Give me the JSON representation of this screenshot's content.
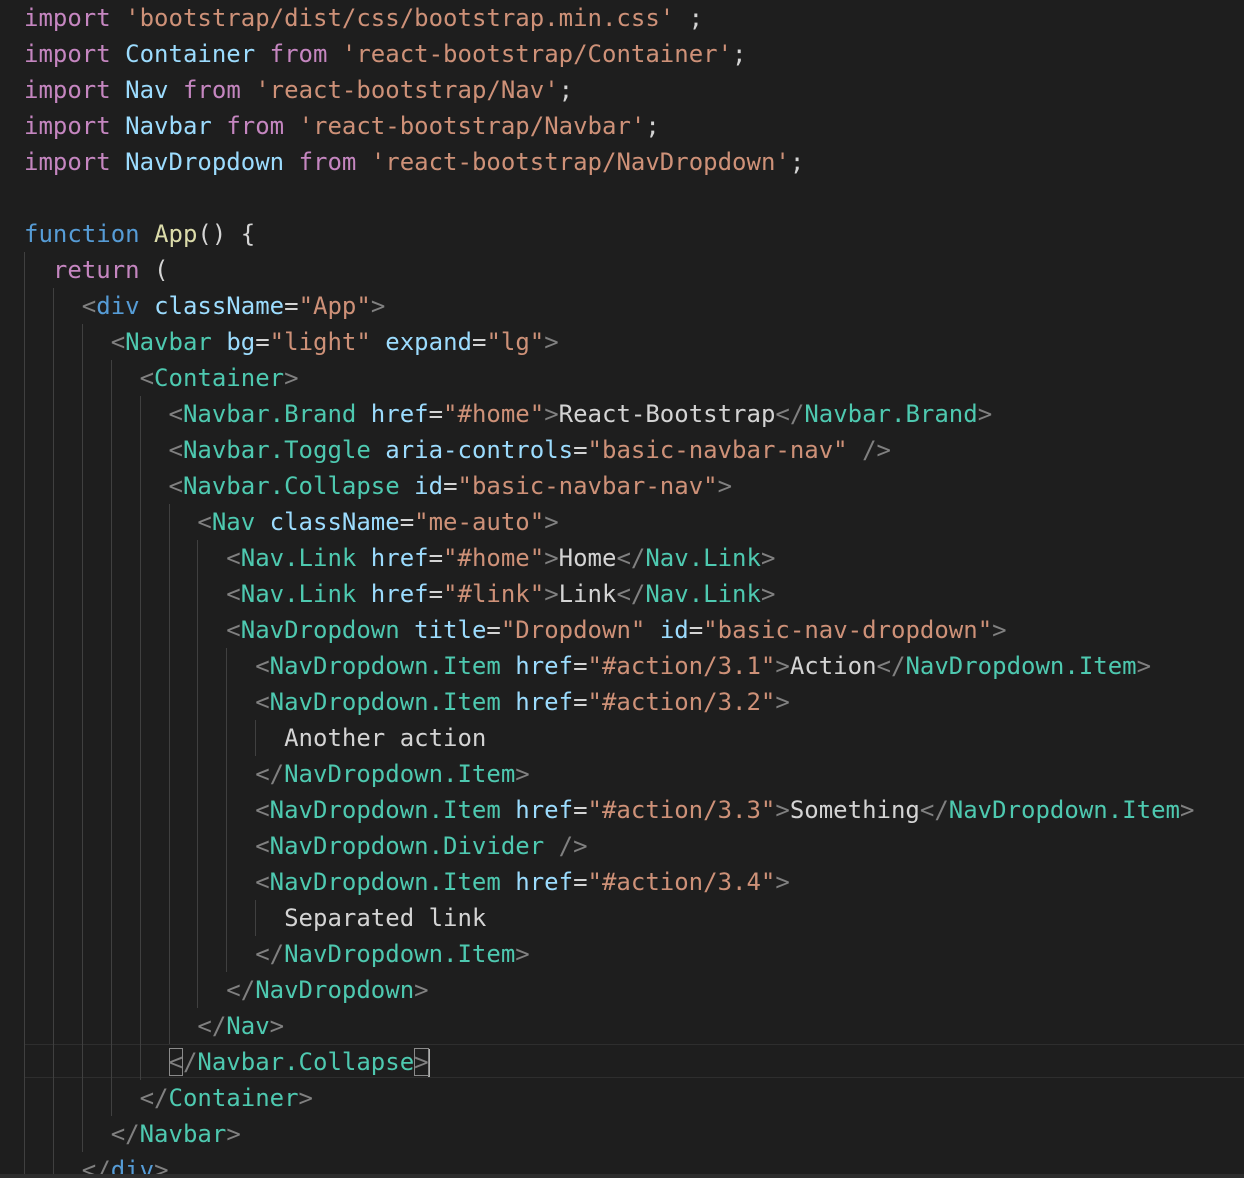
{
  "editor": {
    "colors": {
      "background": "#1e1e1e",
      "plain": "#d4d4d4",
      "keyword": "#c586c0",
      "storage": "#569cd6",
      "identifier": "#9cdcfe",
      "function": "#dcdcaa",
      "string": "#ce9178",
      "tag": "#4ec9b0",
      "tag_punct": "#808080",
      "attr": "#9cdcfe",
      "text": "#d4d4d4"
    },
    "lines": [
      [
        [
          "kw",
          "import"
        ],
        [
          "p",
          " "
        ],
        [
          "str",
          "'bootstrap/dist/css/bootstrap.min.css'"
        ],
        [
          "p",
          " ;"
        ]
      ],
      [
        [
          "kw",
          "import"
        ],
        [
          "p",
          " "
        ],
        [
          "id",
          "Container"
        ],
        [
          "p",
          " "
        ],
        [
          "kw",
          "from"
        ],
        [
          "p",
          " "
        ],
        [
          "str",
          "'react-bootstrap/Container'"
        ],
        [
          "p",
          ";"
        ]
      ],
      [
        [
          "kw",
          "import"
        ],
        [
          "p",
          " "
        ],
        [
          "id",
          "Nav"
        ],
        [
          "p",
          " "
        ],
        [
          "kw",
          "from"
        ],
        [
          "p",
          " "
        ],
        [
          "str",
          "'react-bootstrap/Nav'"
        ],
        [
          "p",
          ";"
        ]
      ],
      [
        [
          "kw",
          "import"
        ],
        [
          "p",
          " "
        ],
        [
          "id",
          "Navbar"
        ],
        [
          "p",
          " "
        ],
        [
          "kw",
          "from"
        ],
        [
          "p",
          " "
        ],
        [
          "str",
          "'react-bootstrap/Navbar'"
        ],
        [
          "p",
          ";"
        ]
      ],
      [
        [
          "kw",
          "import"
        ],
        [
          "p",
          " "
        ],
        [
          "id",
          "NavDropdown"
        ],
        [
          "p",
          " "
        ],
        [
          "kw",
          "from"
        ],
        [
          "p",
          " "
        ],
        [
          "str",
          "'react-bootstrap/NavDropdown'"
        ],
        [
          "p",
          ";"
        ]
      ],
      [],
      [
        [
          "st",
          "function"
        ],
        [
          "p",
          " "
        ],
        [
          "fn",
          "App"
        ],
        [
          "p",
          "() {"
        ]
      ],
      [
        [
          "p",
          "  "
        ],
        [
          "kw",
          "return"
        ],
        [
          "p",
          " ("
        ]
      ],
      [
        [
          "p",
          "    "
        ],
        [
          "tp",
          "<"
        ],
        [
          "st",
          "div"
        ],
        [
          "p",
          " "
        ],
        [
          "at",
          "className"
        ],
        [
          "p",
          "="
        ],
        [
          "str",
          "\"App\""
        ],
        [
          "tp",
          ">"
        ]
      ],
      [
        [
          "p",
          "      "
        ],
        [
          "tp",
          "<"
        ],
        [
          "tg",
          "Navbar"
        ],
        [
          "p",
          " "
        ],
        [
          "at",
          "bg"
        ],
        [
          "p",
          "="
        ],
        [
          "str",
          "\"light\""
        ],
        [
          "p",
          " "
        ],
        [
          "at",
          "expand"
        ],
        [
          "p",
          "="
        ],
        [
          "str",
          "\"lg\""
        ],
        [
          "tp",
          ">"
        ]
      ],
      [
        [
          "p",
          "        "
        ],
        [
          "tp",
          "<"
        ],
        [
          "tg",
          "Container"
        ],
        [
          "tp",
          ">"
        ]
      ],
      [
        [
          "p",
          "          "
        ],
        [
          "tp",
          "<"
        ],
        [
          "tg",
          "Navbar.Brand"
        ],
        [
          "p",
          " "
        ],
        [
          "at",
          "href"
        ],
        [
          "p",
          "="
        ],
        [
          "str",
          "\"#home\""
        ],
        [
          "tp",
          ">"
        ],
        [
          "tx",
          "React-Bootstrap"
        ],
        [
          "tp",
          "</"
        ],
        [
          "tg",
          "Navbar.Brand"
        ],
        [
          "tp",
          ">"
        ]
      ],
      [
        [
          "p",
          "          "
        ],
        [
          "tp",
          "<"
        ],
        [
          "tg",
          "Navbar.Toggle"
        ],
        [
          "p",
          " "
        ],
        [
          "at",
          "aria-controls"
        ],
        [
          "p",
          "="
        ],
        [
          "str",
          "\"basic-navbar-nav\""
        ],
        [
          "p",
          " "
        ],
        [
          "tp",
          "/>"
        ]
      ],
      [
        [
          "p",
          "          "
        ],
        [
          "tp",
          "<"
        ],
        [
          "tg",
          "Navbar.Collapse"
        ],
        [
          "p",
          " "
        ],
        [
          "at",
          "id"
        ],
        [
          "p",
          "="
        ],
        [
          "str",
          "\"basic-navbar-nav\""
        ],
        [
          "tp",
          ">"
        ]
      ],
      [
        [
          "p",
          "            "
        ],
        [
          "tp",
          "<"
        ],
        [
          "tg",
          "Nav"
        ],
        [
          "p",
          " "
        ],
        [
          "at",
          "className"
        ],
        [
          "p",
          "="
        ],
        [
          "str",
          "\"me-auto\""
        ],
        [
          "tp",
          ">"
        ]
      ],
      [
        [
          "p",
          "              "
        ],
        [
          "tp",
          "<"
        ],
        [
          "tg",
          "Nav.Link"
        ],
        [
          "p",
          " "
        ],
        [
          "at",
          "href"
        ],
        [
          "p",
          "="
        ],
        [
          "str",
          "\"#home\""
        ],
        [
          "tp",
          ">"
        ],
        [
          "tx",
          "Home"
        ],
        [
          "tp",
          "</"
        ],
        [
          "tg",
          "Nav.Link"
        ],
        [
          "tp",
          ">"
        ]
      ],
      [
        [
          "p",
          "              "
        ],
        [
          "tp",
          "<"
        ],
        [
          "tg",
          "Nav.Link"
        ],
        [
          "p",
          " "
        ],
        [
          "at",
          "href"
        ],
        [
          "p",
          "="
        ],
        [
          "str",
          "\"#link\""
        ],
        [
          "tp",
          ">"
        ],
        [
          "tx",
          "Link"
        ],
        [
          "tp",
          "</"
        ],
        [
          "tg",
          "Nav.Link"
        ],
        [
          "tp",
          ">"
        ]
      ],
      [
        [
          "p",
          "              "
        ],
        [
          "tp",
          "<"
        ],
        [
          "tg",
          "NavDropdown"
        ],
        [
          "p",
          " "
        ],
        [
          "at",
          "title"
        ],
        [
          "p",
          "="
        ],
        [
          "str",
          "\"Dropdown\""
        ],
        [
          "p",
          " "
        ],
        [
          "at",
          "id"
        ],
        [
          "p",
          "="
        ],
        [
          "str",
          "\"basic-nav-dropdown\""
        ],
        [
          "tp",
          ">"
        ]
      ],
      [
        [
          "p",
          "                "
        ],
        [
          "tp",
          "<"
        ],
        [
          "tg",
          "NavDropdown.Item"
        ],
        [
          "p",
          " "
        ],
        [
          "at",
          "href"
        ],
        [
          "p",
          "="
        ],
        [
          "str",
          "\"#action/3.1\""
        ],
        [
          "tp",
          ">"
        ],
        [
          "tx",
          "Action"
        ],
        [
          "tp",
          "</"
        ],
        [
          "tg",
          "NavDropdown.Item"
        ],
        [
          "tp",
          ">"
        ]
      ],
      [
        [
          "p",
          "                "
        ],
        [
          "tp",
          "<"
        ],
        [
          "tg",
          "NavDropdown.Item"
        ],
        [
          "p",
          " "
        ],
        [
          "at",
          "href"
        ],
        [
          "p",
          "="
        ],
        [
          "str",
          "\"#action/3.2\""
        ],
        [
          "tp",
          ">"
        ]
      ],
      [
        [
          "p",
          "                  "
        ],
        [
          "tx",
          "Another action"
        ]
      ],
      [
        [
          "p",
          "                "
        ],
        [
          "tp",
          "</"
        ],
        [
          "tg",
          "NavDropdown.Item"
        ],
        [
          "tp",
          ">"
        ]
      ],
      [
        [
          "p",
          "                "
        ],
        [
          "tp",
          "<"
        ],
        [
          "tg",
          "NavDropdown.Item"
        ],
        [
          "p",
          " "
        ],
        [
          "at",
          "href"
        ],
        [
          "p",
          "="
        ],
        [
          "str",
          "\"#action/3.3\""
        ],
        [
          "tp",
          ">"
        ],
        [
          "tx",
          "Something"
        ],
        [
          "tp",
          "</"
        ],
        [
          "tg",
          "NavDropdown.Item"
        ],
        [
          "tp",
          ">"
        ]
      ],
      [
        [
          "p",
          "                "
        ],
        [
          "tp",
          "<"
        ],
        [
          "tg",
          "NavDropdown.Divider"
        ],
        [
          "p",
          " "
        ],
        [
          "tp",
          "/>"
        ]
      ],
      [
        [
          "p",
          "                "
        ],
        [
          "tp",
          "<"
        ],
        [
          "tg",
          "NavDropdown.Item"
        ],
        [
          "p",
          " "
        ],
        [
          "at",
          "href"
        ],
        [
          "p",
          "="
        ],
        [
          "str",
          "\"#action/3.4\""
        ],
        [
          "tp",
          ">"
        ]
      ],
      [
        [
          "p",
          "                  "
        ],
        [
          "tx",
          "Separated link"
        ]
      ],
      [
        [
          "p",
          "                "
        ],
        [
          "tp",
          "</"
        ],
        [
          "tg",
          "NavDropdown.Item"
        ],
        [
          "tp",
          ">"
        ]
      ],
      [
        [
          "p",
          "              "
        ],
        [
          "tp",
          "</"
        ],
        [
          "tg",
          "NavDropdown"
        ],
        [
          "tp",
          ">"
        ]
      ],
      [
        [
          "p",
          "            "
        ],
        [
          "tp",
          "</"
        ],
        [
          "tg",
          "Nav"
        ],
        [
          "tp",
          ">"
        ]
      ],
      [
        [
          "p",
          "          "
        ],
        [
          "tpb",
          "<"
        ],
        [
          "tp",
          "/"
        ],
        [
          "tg",
          "Navbar.Collapse"
        ],
        [
          "tpb",
          ">"
        ],
        [
          "cur",
          ""
        ]
      ],
      [
        [
          "p",
          "        "
        ],
        [
          "tp",
          "</"
        ],
        [
          "tg",
          "Container"
        ],
        [
          "tp",
          ">"
        ]
      ],
      [
        [
          "p",
          "      "
        ],
        [
          "tp",
          "</"
        ],
        [
          "tg",
          "Navbar"
        ],
        [
          "tp",
          ">"
        ]
      ],
      [
        [
          "p",
          "    "
        ],
        [
          "tp",
          "</"
        ],
        [
          "st",
          "div"
        ],
        [
          "tp",
          ">"
        ]
      ]
    ]
  }
}
